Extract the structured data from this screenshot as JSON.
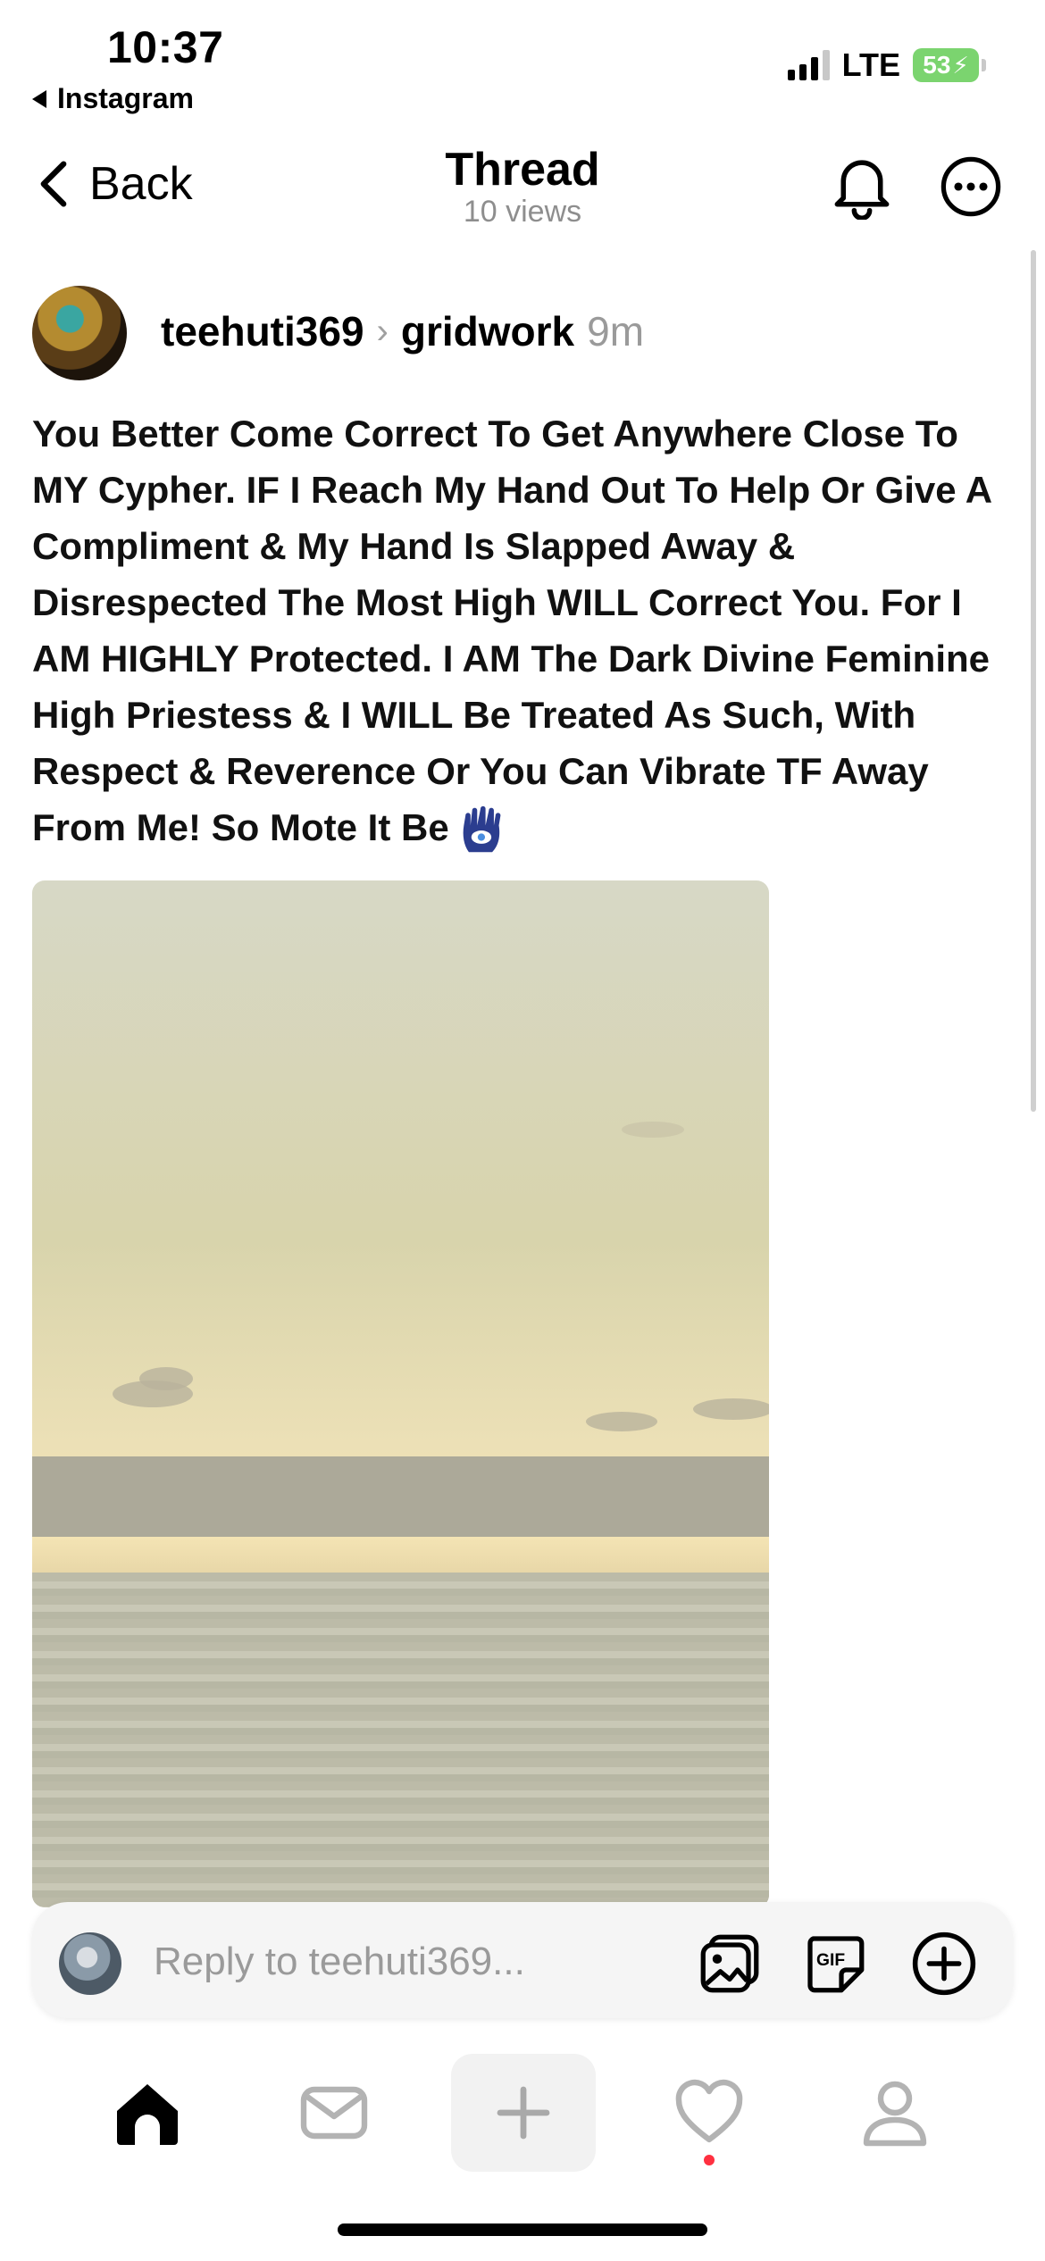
{
  "status_bar": {
    "time": "10:37",
    "back_app": "Instagram",
    "network": "LTE",
    "battery": "53",
    "icons": [
      "signal-icon",
      "battery-charging-icon"
    ]
  },
  "header": {
    "back_label": "Back",
    "title": "Thread",
    "views": "10 views",
    "icons": [
      "chevron-left-icon",
      "bell-icon",
      "more-icon"
    ]
  },
  "post": {
    "username": "teehuti369",
    "topic": "gridwork",
    "time": "9m",
    "text": "You Better Come Correct To Get Anywhere Close To MY Cypher. IF I Reach My Hand Out To Help Or Give A Compliment & My Hand Is Slapped Away & Disrespected The Most High WILL Correct You. For I AM HIGHLY Protected. I AM The Dark Divine Feminine High Priestess & I WILL Be Treated As Such, With Respect & Reverence Or You Can Vibrate TF Away From Me! So Mote It Be",
    "emoji": "hamsa-icon"
  },
  "reply": {
    "placeholder": "Reply to teehuti369...",
    "gif_label": "GIF",
    "icons": [
      "image-icon",
      "gif-icon",
      "plus-circle-icon"
    ]
  },
  "tabbar": {
    "items": [
      "home-icon",
      "inbox-icon",
      "new-post-icon",
      "activity-icon",
      "profile-icon"
    ],
    "active": "home-icon",
    "notification_color": "#ff3040"
  }
}
